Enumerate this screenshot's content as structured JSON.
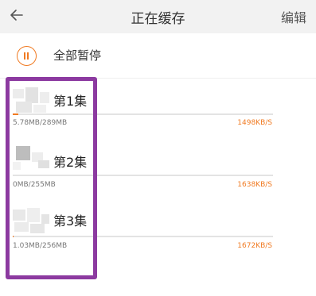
{
  "header": {
    "title": "正在缓存",
    "edit_label": "编辑"
  },
  "pause_all": {
    "label": "全部暂停"
  },
  "accent_color": "#f07a22",
  "highlight_color": "#8c3aa0",
  "items": [
    {
      "label": "第1集",
      "size": "5.78MB/289MB",
      "speed": "1498KB/S",
      "progress": 0.02
    },
    {
      "label": "第2集",
      "size": "0MB/255MB",
      "speed": "1638KB/S",
      "progress": 0.0
    },
    {
      "label": "第3集",
      "size": "1.03MB/256MB",
      "speed": "1672KB/S",
      "progress": 0.004
    }
  ]
}
